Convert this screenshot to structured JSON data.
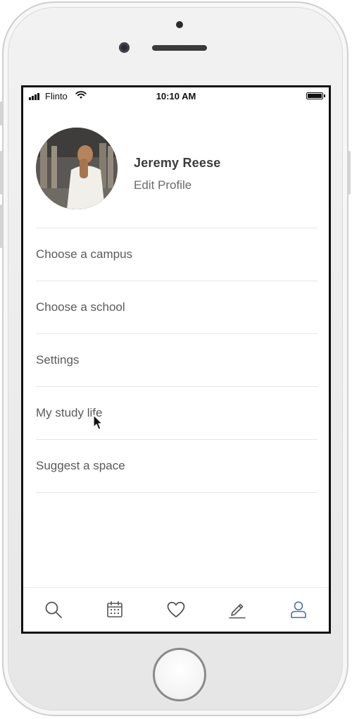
{
  "status_bar": {
    "carrier": "Flinto",
    "time": "10:10 AM",
    "signal_bars": 4,
    "battery_level": 1.0
  },
  "profile": {
    "name": "Jeremy Reese",
    "edit_label": "Edit Profile"
  },
  "menu": {
    "items": [
      {
        "label": "Choose a campus"
      },
      {
        "label": "Choose a school"
      },
      {
        "label": "Settings"
      },
      {
        "label": "My study life"
      },
      {
        "label": "Suggest a space"
      }
    ]
  },
  "tab_bar": {
    "tabs": [
      {
        "icon": "search-icon",
        "active": false
      },
      {
        "icon": "calendar-icon",
        "active": false
      },
      {
        "icon": "heart-icon",
        "active": false
      },
      {
        "icon": "pencil-icon",
        "active": false
      },
      {
        "icon": "user-icon",
        "active": true
      }
    ],
    "active_color": "#4a6fa5",
    "inactive_color": "#555555"
  }
}
